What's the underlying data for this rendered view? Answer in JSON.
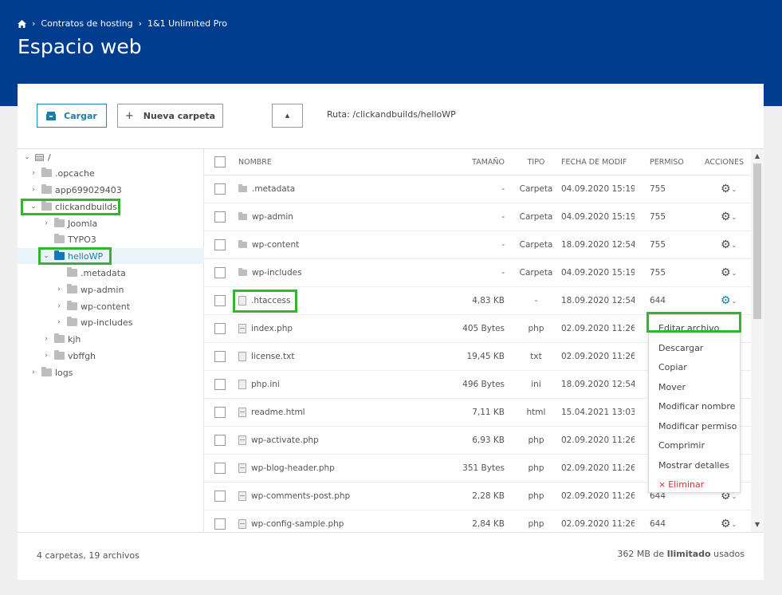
{
  "header": {
    "breadcrumb": [
      "Contratos de hosting",
      "1&1 Unlimited Pro"
    ],
    "title": "Espacio web"
  },
  "toolbar": {
    "upload_label": "Cargar",
    "new_folder_label": "Nueva carpeta",
    "up_label": "▲",
    "route": "Ruta: /clickandbuilds/helloWP"
  },
  "tree": {
    "root": "/",
    "items": [
      {
        "label": ".opcache"
      },
      {
        "label": "app699029403"
      },
      {
        "label": "clickandbuilds"
      },
      {
        "label": "Joomla"
      },
      {
        "label": "TYPO3"
      },
      {
        "label": "helloWP"
      },
      {
        "label": ".metadata"
      },
      {
        "label": "wp-admin"
      },
      {
        "label": "wp-content"
      },
      {
        "label": "wp-includes"
      },
      {
        "label": "kjh"
      },
      {
        "label": "vbffgh"
      },
      {
        "label": "logs"
      }
    ]
  },
  "table": {
    "columns": [
      "NOMBRE",
      "TAMAÑO",
      "TIPO",
      "FECHA DE MODIF",
      "PERMISO",
      "ACCIONES"
    ],
    "rows": [
      {
        "name": ".metadata",
        "size": "-",
        "type": "Carpeta",
        "date": "04.09.2020 15:19",
        "perm": "755",
        "kind": "dir"
      },
      {
        "name": "wp-admin",
        "size": "-",
        "type": "Carpeta",
        "date": "04.09.2020 15:19",
        "perm": "755",
        "kind": "dir"
      },
      {
        "name": "wp-content",
        "size": "-",
        "type": "Carpeta",
        "date": "18.09.2020 12:54",
        "perm": "755",
        "kind": "dir"
      },
      {
        "name": "wp-includes",
        "size": "-",
        "type": "Carpeta",
        "date": "04.09.2020 15:19",
        "perm": "755",
        "kind": "dir"
      },
      {
        "name": ".htaccess",
        "size": "4,83 KB",
        "type": "-",
        "date": "18.09.2020 12:54",
        "perm": "644",
        "kind": "file"
      },
      {
        "name": "index.php",
        "size": "405 Bytes",
        "type": "php",
        "date": "02.09.2020 11:26",
        "perm": "",
        "kind": "code"
      },
      {
        "name": "license.txt",
        "size": "19,45 KB",
        "type": "txt",
        "date": "02.09.2020 11:26",
        "perm": "",
        "kind": "file"
      },
      {
        "name": "php.ini",
        "size": "496 Bytes",
        "type": "ini",
        "date": "18.09.2020 12:54",
        "perm": "",
        "kind": "file"
      },
      {
        "name": "readme.html",
        "size": "7,11 KB",
        "type": "html",
        "date": "15.04.2021 13:03",
        "perm": "",
        "kind": "code"
      },
      {
        "name": "wp-activate.php",
        "size": "6,93 KB",
        "type": "php",
        "date": "02.09.2020 11:26",
        "perm": "",
        "kind": "code"
      },
      {
        "name": "wp-blog-header.php",
        "size": "351 Bytes",
        "type": "php",
        "date": "02.09.2020 11:26",
        "perm": "",
        "kind": "code"
      },
      {
        "name": "wp-comments-post.php",
        "size": "2,28 KB",
        "type": "php",
        "date": "02.09.2020 11:26",
        "perm": "644",
        "kind": "code"
      },
      {
        "name": "wp-config-sample.php",
        "size": "2,84 KB",
        "type": "php",
        "date": "02.09.2020 11:26",
        "perm": "644",
        "kind": "code"
      }
    ]
  },
  "context_menu": {
    "items": [
      "Editar archivo",
      "Descargar",
      "Copiar",
      "Mover",
      "Modificar nombre",
      "Modificar permiso",
      "Comprimir",
      "Mostrar detalles"
    ],
    "delete_label": "Eliminar"
  },
  "footer": {
    "summary": "4 carpetas, 19 archivos",
    "usage_prefix": "362 MB de",
    "usage_bold": "Ilimitado",
    "usage_suffix": "usados"
  },
  "colors": {
    "header_bg": "#003d8f",
    "accent": "#1a7fa6",
    "highlight": "#35b52f"
  }
}
